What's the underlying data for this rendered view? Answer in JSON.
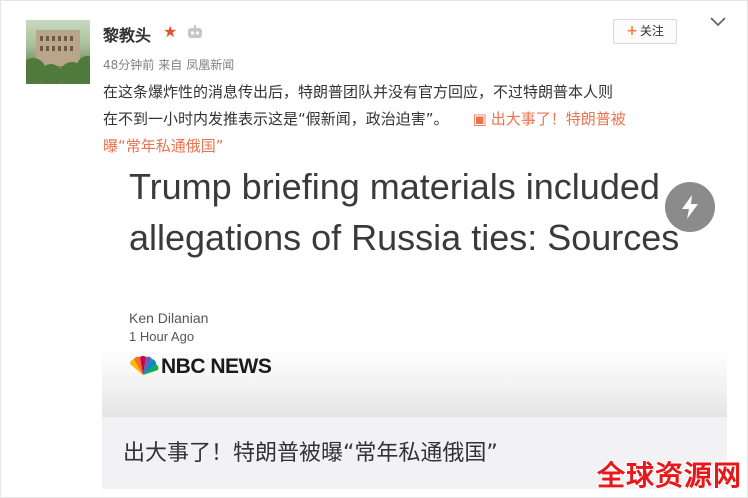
{
  "user": {
    "name": "黎教头",
    "vip_icon": "star-icon",
    "badge_icon": "badge-icon"
  },
  "meta": {
    "time": "48分钟前",
    "source_prefix": "来自",
    "source": "凤凰新闻"
  },
  "follow_button": {
    "label": "关注",
    "icon": "plus-icon"
  },
  "post": {
    "line1": "在这条爆炸性的消息传出后，特朗普团队并没有官方回应，不过特朗普本人则",
    "line2": "在不到一小时内发推表示这是“假新闻，政治迫害”。",
    "link_icon": "link-icon",
    "link_text_1": "出大事了！特朗普被",
    "link_text_2": "曝“常年私通俄国”"
  },
  "card": {
    "headline": "Trump briefing materials included allegations of Russia ties: Sources",
    "author": "Ken Dilanian",
    "time_ago": "1 Hour Ago",
    "logo_text": "NBC NEWS",
    "logo_icon": "peacock-icon",
    "play_icon": "lightning-play-icon"
  },
  "caption": {
    "text": "出大事了！特朗普被曝“常年私通俄国”"
  },
  "watermark": {
    "text": "全球资源网"
  },
  "colors": {
    "link": "#eb7350",
    "vip_star": "#e8502d",
    "watermark": "#e8171a",
    "caption_bg": "#f2f2f5"
  }
}
